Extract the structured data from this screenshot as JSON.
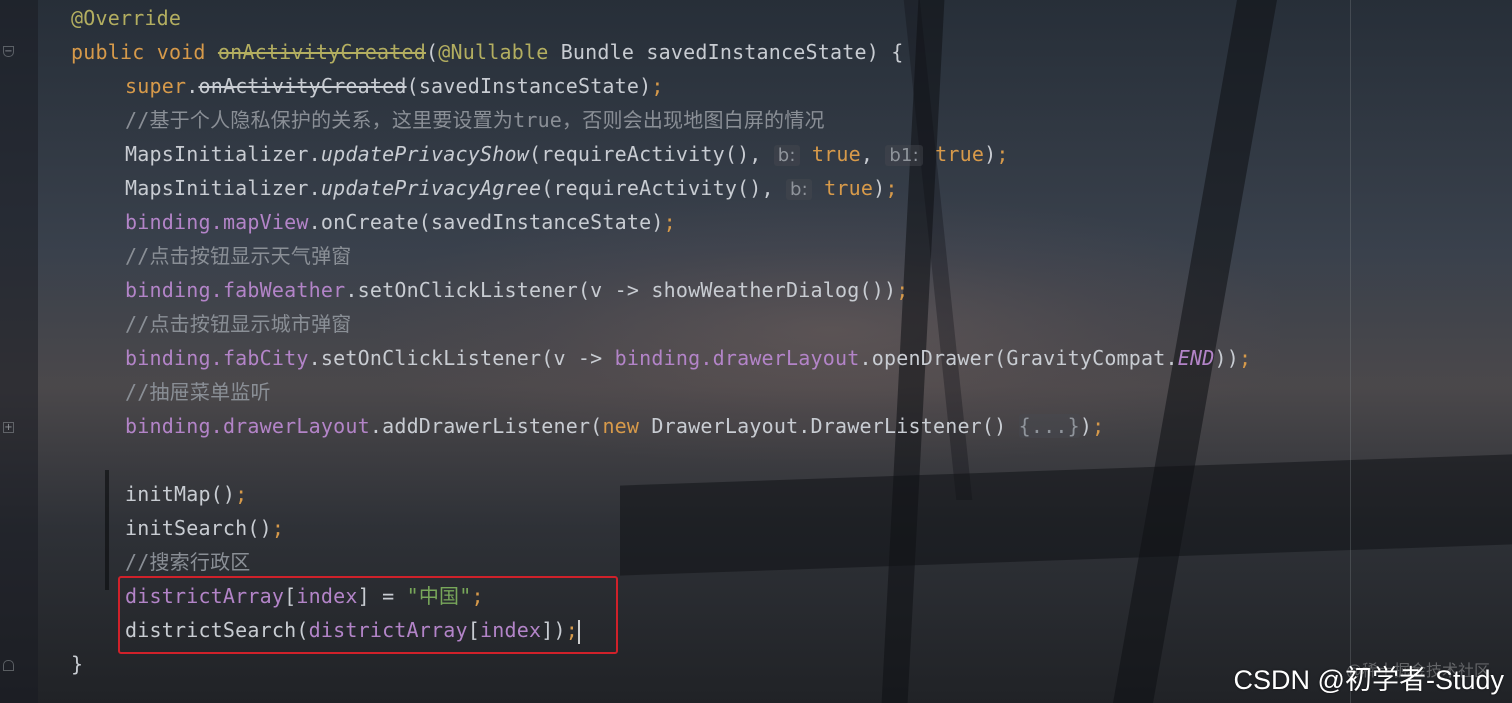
{
  "editor": {
    "l1": {
      "annotation": "@Override"
    },
    "l2": {
      "public": "public",
      "void": "void",
      "method": "onActivityCreated",
      "open": "(",
      "nullable": "@Nullable",
      "rest": " Bundle savedInstanceState) {"
    },
    "l3": {
      "super": "super",
      "dot": ".",
      "method": "onActivityCreated",
      "rest": "(savedInstanceState)",
      "semi": ";"
    },
    "l4": {
      "comment": "//基于个人隐私保护的关系，这里要设置为true，否则会出现地图白屏的情况"
    },
    "l5": {
      "a": "MapsInitializer.",
      "m": "updatePrivacyShow",
      "b": "(requireActivity(), ",
      "h1": "b:",
      "t1": " true",
      "c": ", ",
      "h2": "b1:",
      "t2": " true",
      "d": ")",
      "semi": ";"
    },
    "l6": {
      "a": "MapsInitializer.",
      "m": "updatePrivacyAgree",
      "b": "(requireActivity(), ",
      "h1": "b:",
      "t1": " true",
      "d": ")",
      "semi": ";"
    },
    "l7": {
      "a": "binding.",
      "f": "mapView",
      "b": ".onCreate(savedInstanceState)",
      "semi": ";"
    },
    "l8": {
      "comment": "//点击按钮显示天气弹窗"
    },
    "l9": {
      "a": "binding.",
      "f": "fabWeather",
      "b": ".setOnClickListener(v -> showWeatherDialog())",
      "semi": ";"
    },
    "l10": {
      "comment": "//点击按钮显示城市弹窗"
    },
    "l11": {
      "a": "binding.",
      "f": "fabCity",
      "b": ".setOnClickListener(v -> ",
      "a2": "binding.",
      "f2": "drawerLayout",
      "c": ".openDrawer(GravityCompat.",
      "e": "END",
      "d": "))",
      "semi": ";"
    },
    "l12": {
      "comment": "//抽屉菜单监听"
    },
    "l13": {
      "a": "binding.",
      "f": "drawerLayout",
      "b": ".addDrawerListener(",
      "new": "new",
      "c": " DrawerLayout.DrawerListener() ",
      "fold": "{...}",
      "d": ")",
      "semi": ";"
    },
    "l15": {
      "a": "initMap()",
      "semi": ";"
    },
    "l16": {
      "a": "initSearch()",
      "semi": ";"
    },
    "l17": {
      "comment": "//搜索行政区"
    },
    "l18": {
      "f": "districtArray",
      "b": "[",
      "f2": "index",
      "c": "] = ",
      "s": "\"中国\"",
      "semi": ";"
    },
    "l19": {
      "a": "districtSearch(",
      "f": "districtArray",
      "b": "[",
      "f2": "index",
      "c": "])",
      "semi": ";"
    },
    "l20": {
      "brace": "}"
    }
  },
  "watermark": {
    "main": "CSDN @初学者-Study",
    "faint": "@稀土掘金技术社区"
  },
  "colors": {
    "keyword": "#d79a4a",
    "annotation": "#b3ae60",
    "comment": "#8a8f96",
    "field": "#b384c8",
    "string": "#78a75a",
    "highlight_box": "#d0212a"
  }
}
